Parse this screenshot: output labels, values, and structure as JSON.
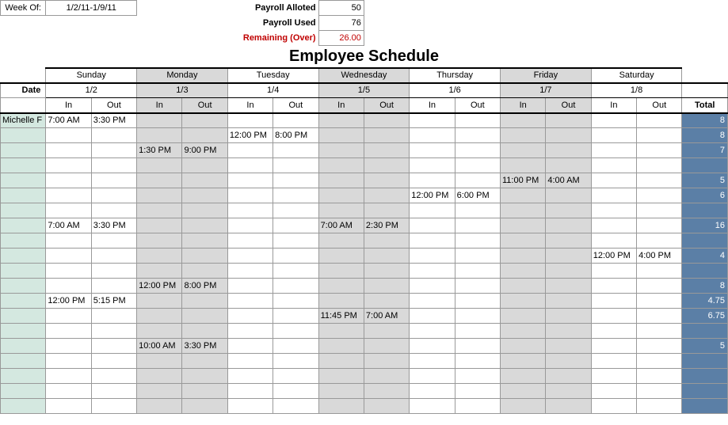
{
  "header": {
    "week_of_label": "Week Of:",
    "week_of_value": "1/2/11-1/9/11",
    "payroll_alloted_label": "Payroll Alloted",
    "payroll_alloted_value": "50",
    "payroll_used_label": "Payroll Used",
    "payroll_used_value": "76",
    "remaining_label": "Remaining (Over)",
    "remaining_value": "26.00"
  },
  "title": "Employee Schedule",
  "columns": {
    "date_label": "Date",
    "in_label": "In",
    "out_label": "Out",
    "total_label": "Total",
    "days": [
      {
        "name": "Sunday",
        "date": "1/2",
        "shade": false
      },
      {
        "name": "Monday",
        "date": "1/3",
        "shade": true
      },
      {
        "name": "Tuesday",
        "date": "1/4",
        "shade": false
      },
      {
        "name": "Wednesday",
        "date": "1/5",
        "shade": true
      },
      {
        "name": "Thursday",
        "date": "1/6",
        "shade": false
      },
      {
        "name": "Friday",
        "date": "1/7",
        "shade": true
      },
      {
        "name": "Saturday",
        "date": "1/8",
        "shade": false
      }
    ]
  },
  "rows": [
    {
      "name": "Michelle F",
      "cells": [
        "7:00 AM",
        "3:30 PM",
        "",
        "",
        "",
        "",
        "",
        "",
        "",
        "",
        "",
        "",
        "",
        ""
      ],
      "total": "8"
    },
    {
      "name": "",
      "cells": [
        "",
        "",
        "",
        "",
        "12:00 PM",
        "8:00 PM",
        "",
        "",
        "",
        "",
        "",
        "",
        "",
        ""
      ],
      "total": "8"
    },
    {
      "name": "",
      "cells": [
        "",
        "",
        "1:30 PM",
        "9:00 PM",
        "",
        "",
        "",
        "",
        "",
        "",
        "",
        "",
        "",
        ""
      ],
      "total": "7"
    },
    {
      "name": "",
      "cells": [
        "",
        "",
        "",
        "",
        "",
        "",
        "",
        "",
        "",
        "",
        "",
        "",
        "",
        ""
      ],
      "total": ""
    },
    {
      "name": "",
      "cells": [
        "",
        "",
        "",
        "",
        "",
        "",
        "",
        "",
        "",
        "",
        "11:00 PM",
        "4:00 AM",
        "",
        ""
      ],
      "total": "5"
    },
    {
      "name": "",
      "cells": [
        "",
        "",
        "",
        "",
        "",
        "",
        "",
        "",
        "12:00 PM",
        "6:00 PM",
        "",
        "",
        "",
        ""
      ],
      "total": "6"
    },
    {
      "name": "",
      "cells": [
        "",
        "",
        "",
        "",
        "",
        "",
        "",
        "",
        "",
        "",
        "",
        "",
        "",
        ""
      ],
      "total": ""
    },
    {
      "name": "",
      "cells": [
        "7:00 AM",
        "3:30 PM",
        "",
        "",
        "",
        "",
        "7:00 AM",
        "2:30 PM",
        "",
        "",
        "",
        "",
        "",
        ""
      ],
      "total": "16"
    },
    {
      "name": "",
      "cells": [
        "",
        "",
        "",
        "",
        "",
        "",
        "",
        "",
        "",
        "",
        "",
        "",
        "",
        ""
      ],
      "total": ""
    },
    {
      "name": "",
      "cells": [
        "",
        "",
        "",
        "",
        "",
        "",
        "",
        "",
        "",
        "",
        "",
        "",
        "12:00 PM",
        "4:00 PM"
      ],
      "total": "4"
    },
    {
      "name": "",
      "cells": [
        "",
        "",
        "",
        "",
        "",
        "",
        "",
        "",
        "",
        "",
        "",
        "",
        "",
        ""
      ],
      "total": ""
    },
    {
      "name": "",
      "cells": [
        "",
        "",
        "12:00 PM",
        "8:00 PM",
        "",
        "",
        "",
        "",
        "",
        "",
        "",
        "",
        "",
        ""
      ],
      "total": "8"
    },
    {
      "name": "",
      "cells": [
        "12:00 PM",
        "5:15 PM",
        "",
        "",
        "",
        "",
        "",
        "",
        "",
        "",
        "",
        "",
        "",
        ""
      ],
      "total": "4.75"
    },
    {
      "name": "",
      "cells": [
        "",
        "",
        "",
        "",
        "",
        "",
        "11:45 PM",
        "7:00 AM",
        "",
        "",
        "",
        "",
        "",
        ""
      ],
      "total": "6.75"
    },
    {
      "name": "",
      "cells": [
        "",
        "",
        "",
        "",
        "",
        "",
        "",
        "",
        "",
        "",
        "",
        "",
        "",
        ""
      ],
      "total": ""
    },
    {
      "name": "",
      "cells": [
        "",
        "",
        "10:00 AM",
        "3:30 PM",
        "",
        "",
        "",
        "",
        "",
        "",
        "",
        "",
        "",
        ""
      ],
      "total": "5"
    },
    {
      "name": "",
      "cells": [
        "",
        "",
        "",
        "",
        "",
        "",
        "",
        "",
        "",
        "",
        "",
        "",
        "",
        ""
      ],
      "total": ""
    },
    {
      "name": "",
      "cells": [
        "",
        "",
        "",
        "",
        "",
        "",
        "",
        "",
        "",
        "",
        "",
        "",
        "",
        ""
      ],
      "total": ""
    },
    {
      "name": "",
      "cells": [
        "",
        "",
        "",
        "",
        "",
        "",
        "",
        "",
        "",
        "",
        "",
        "",
        "",
        ""
      ],
      "total": ""
    },
    {
      "name": "",
      "cells": [
        "",
        "",
        "",
        "",
        "",
        "",
        "",
        "",
        "",
        "",
        "",
        "",
        "",
        ""
      ],
      "total": ""
    }
  ],
  "chart_data": {
    "type": "table",
    "title": "Employee Schedule",
    "week": "1/2/11-1/9/11",
    "payroll_alloted": 50,
    "payroll_used": 76,
    "remaining_over": 26.0,
    "columns": [
      "Employee",
      "Sun In",
      "Sun Out",
      "Mon In",
      "Mon Out",
      "Tue In",
      "Tue Out",
      "Wed In",
      "Wed Out",
      "Thu In",
      "Thu Out",
      "Fri In",
      "Fri Out",
      "Sat In",
      "Sat Out",
      "Total"
    ],
    "dates": [
      "1/2",
      "1/3",
      "1/4",
      "1/5",
      "1/6",
      "1/7",
      "1/8"
    ],
    "rows": [
      [
        "Michelle F",
        "7:00 AM",
        "3:30 PM",
        "",
        "",
        "",
        "",
        "",
        "",
        "",
        "",
        "",
        "",
        "",
        "",
        8
      ],
      [
        "",
        "",
        "",
        "",
        "",
        "12:00 PM",
        "8:00 PM",
        "",
        "",
        "",
        "",
        "",
        "",
        "",
        "",
        8
      ],
      [
        "",
        "",
        "",
        "1:30 PM",
        "9:00 PM",
        "",
        "",
        "",
        "",
        "",
        "",
        "",
        "",
        "",
        "",
        7
      ],
      [
        "",
        "",
        "",
        "",
        "",
        "",
        "",
        "",
        "",
        "",
        "",
        "11:00 PM",
        "4:00 AM",
        "",
        "",
        5
      ],
      [
        "",
        "",
        "",
        "",
        "",
        "",
        "",
        "",
        "",
        "12:00 PM",
        "6:00 PM",
        "",
        "",
        "",
        "",
        6
      ],
      [
        "",
        "7:00 AM",
        "3:30 PM",
        "",
        "",
        "",
        "",
        "7:00 AM",
        "2:30 PM",
        "",
        "",
        "",
        "",
        "",
        "",
        16
      ],
      [
        "",
        "",
        "",
        "",
        "",
        "",
        "",
        "",
        "",
        "",
        "",
        "",
        "",
        "12:00 PM",
        "4:00 PM",
        4
      ],
      [
        "",
        "",
        "",
        "12:00 PM",
        "8:00 PM",
        "",
        "",
        "",
        "",
        "",
        "",
        "",
        "",
        "",
        "",
        8
      ],
      [
        "",
        "12:00 PM",
        "5:15 PM",
        "",
        "",
        "",
        "",
        "",
        "",
        "",
        "",
        "",
        "",
        "",
        "",
        4.75
      ],
      [
        "",
        "",
        "",
        "",
        "",
        "",
        "",
        "11:45 PM",
        "7:00 AM",
        "",
        "",
        "",
        "",
        "",
        "",
        6.75
      ],
      [
        "",
        "",
        "",
        "10:00 AM",
        "3:30 PM",
        "",
        "",
        "",
        "",
        "",
        "",
        "",
        "",
        "",
        "",
        5
      ]
    ]
  }
}
